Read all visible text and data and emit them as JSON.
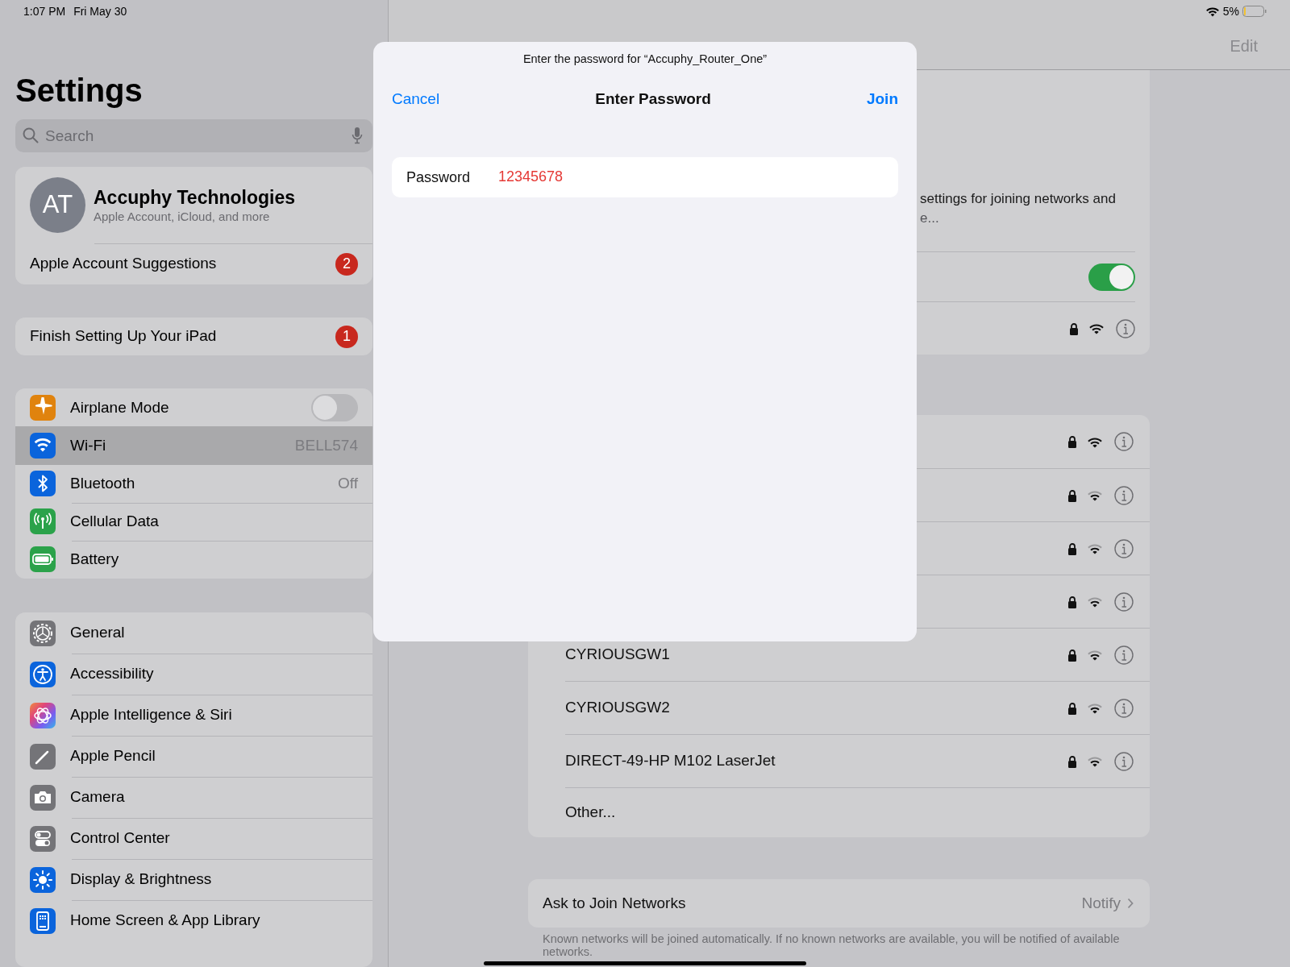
{
  "status_bar": {
    "time": "1:07 PM",
    "date": "Fri May 30",
    "battery": "5%"
  },
  "sidebar": {
    "title": "Settings",
    "search": {
      "placeholder": "Search"
    },
    "account": {
      "initials": "AT",
      "name": "Accuphy Technologies",
      "subtitle": "Apple Account, iCloud, and more",
      "suggestions": {
        "label": "Apple Account Suggestions",
        "badge": "2"
      }
    },
    "finish_setup": {
      "label": "Finish Setting Up Your iPad",
      "badge": "1"
    },
    "groups": [
      {
        "items": [
          {
            "label": "Airplane Mode",
            "kind": "toggle",
            "on": false,
            "selected": false
          },
          {
            "label": "Wi-Fi",
            "kind": "value",
            "value": "BELL574",
            "selected": true
          },
          {
            "label": "Bluetooth",
            "kind": "value",
            "value": "Off",
            "selected": false
          },
          {
            "label": "Cellular Data",
            "kind": "plain",
            "selected": false
          },
          {
            "label": "Battery",
            "kind": "plain",
            "selected": false
          }
        ]
      },
      {
        "items": [
          {
            "label": "General",
            "kind": "plain",
            "selected": false
          },
          {
            "label": "Accessibility",
            "kind": "plain",
            "selected": false
          },
          {
            "label": "Apple Intelligence & Siri",
            "kind": "plain",
            "selected": false
          },
          {
            "label": "Apple Pencil",
            "kind": "plain",
            "selected": false
          },
          {
            "label": "Camera",
            "kind": "plain",
            "selected": false
          },
          {
            "label": "Control Center",
            "kind": "plain",
            "selected": false
          },
          {
            "label": "Display & Brightness",
            "kind": "plain",
            "selected": false
          },
          {
            "label": "Home Screen & App Library",
            "kind": "plain",
            "selected": false
          }
        ]
      }
    ]
  },
  "detail": {
    "edit": "Edit",
    "intro_lines": [
      "settings for joining networks and",
      "e..."
    ],
    "wifi_toggle": {
      "on": true
    },
    "connected": {
      "kind": "strong"
    },
    "networks": [
      {
        "kind": "strong"
      },
      {
        "kind": "medium"
      },
      {
        "kind": "medium"
      },
      {
        "kind": "medium"
      },
      {
        "name": "CYRIOUSGW1",
        "kind": "medium"
      },
      {
        "name": "CYRIOUSGW2",
        "kind": "medium"
      },
      {
        "name": "DIRECT-49-HP M102 LaserJet",
        "kind": "medium"
      }
    ],
    "other": "Other...",
    "ask_to_join": {
      "label": "Ask to Join Networks",
      "value": "Notify"
    },
    "footnote": "Known networks will be joined automatically. If no known networks are available, you will be notified of available networks."
  },
  "dialog": {
    "prompt": "Enter the password for “Accuphy_Router_One”",
    "cancel": "Cancel",
    "title": "Enter Password",
    "join": "Join",
    "field": {
      "label": "Password",
      "value": "12345678"
    }
  }
}
